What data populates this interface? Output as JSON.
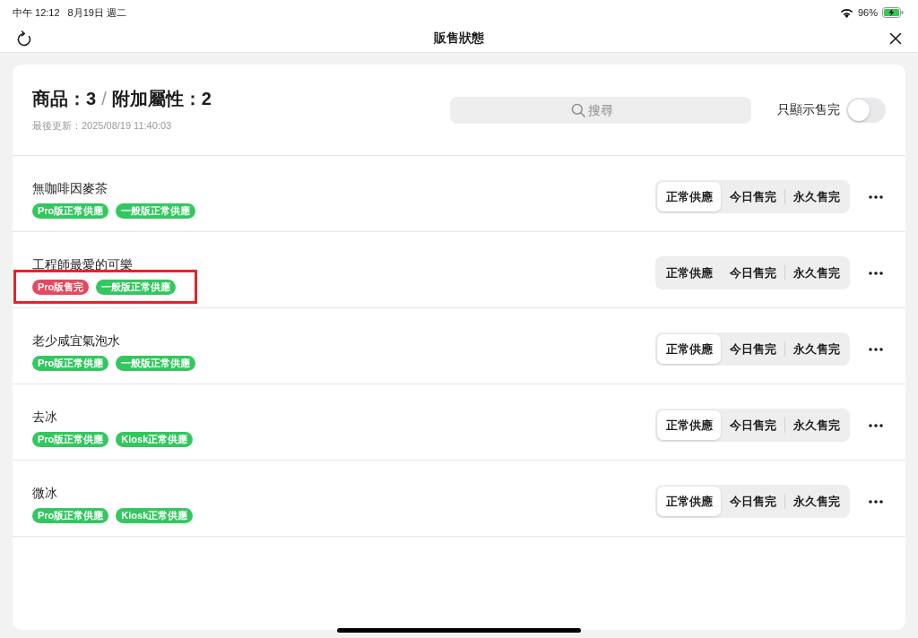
{
  "status_bar": {
    "time": "中午 12:12",
    "date": "8月19日 週二",
    "battery": "96%"
  },
  "nav": {
    "title": "販售狀態"
  },
  "header": {
    "products": "商品：3",
    "separator": "/",
    "attributes": "附加屬性：2",
    "updated": "最後更新：2025/08/19 11:40:03"
  },
  "search": {
    "placeholder": "搜尋"
  },
  "filter": {
    "label": "只顯示售完",
    "on": false
  },
  "items": [
    {
      "name": "無咖啡因麥茶",
      "highlighted": false,
      "tags": [
        {
          "label": "Pro版正常供應",
          "color": "#33c75f"
        },
        {
          "label": "一般版正常供應",
          "color": "#33c75f"
        }
      ],
      "segments": [
        {
          "label": "正常供應",
          "selected": true
        },
        {
          "label": "今日售完",
          "selected": false
        },
        {
          "label": "永久售完",
          "selected": false
        }
      ]
    },
    {
      "name": "工程師最愛的可樂",
      "highlighted": true,
      "tags": [
        {
          "label": "Pro版售完",
          "color": "#e8485d"
        },
        {
          "label": "一般版正常供應",
          "color": "#33c75f"
        }
      ],
      "segments": [
        {
          "label": "正常供應",
          "selected": false
        },
        {
          "label": "今日售完",
          "selected": false
        },
        {
          "label": "永久售完",
          "selected": false
        }
      ]
    },
    {
      "name": "老少咸宜氣泡水",
      "highlighted": false,
      "tags": [
        {
          "label": "Pro版正常供應",
          "color": "#33c75f"
        },
        {
          "label": "一般版正常供應",
          "color": "#33c75f"
        }
      ],
      "segments": [
        {
          "label": "正常供應",
          "selected": true
        },
        {
          "label": "今日售完",
          "selected": false
        },
        {
          "label": "永久售完",
          "selected": false
        }
      ]
    },
    {
      "name": "去冰",
      "highlighted": false,
      "tags": [
        {
          "label": "Pro版正常供應",
          "color": "#33c75f"
        },
        {
          "label": "Kiosk正常供應",
          "color": "#33c75f"
        }
      ],
      "segments": [
        {
          "label": "正常供應",
          "selected": true
        },
        {
          "label": "今日售完",
          "selected": false
        },
        {
          "label": "永久售完",
          "selected": false
        }
      ]
    },
    {
      "name": "微冰",
      "highlighted": false,
      "tags": [
        {
          "label": "Pro版正常供應",
          "color": "#33c75f"
        },
        {
          "label": "Kiosk正常供應",
          "color": "#33c75f"
        }
      ],
      "segments": [
        {
          "label": "正常供應",
          "selected": true
        },
        {
          "label": "今日售完",
          "selected": false
        },
        {
          "label": "永久售完",
          "selected": false
        }
      ]
    }
  ]
}
